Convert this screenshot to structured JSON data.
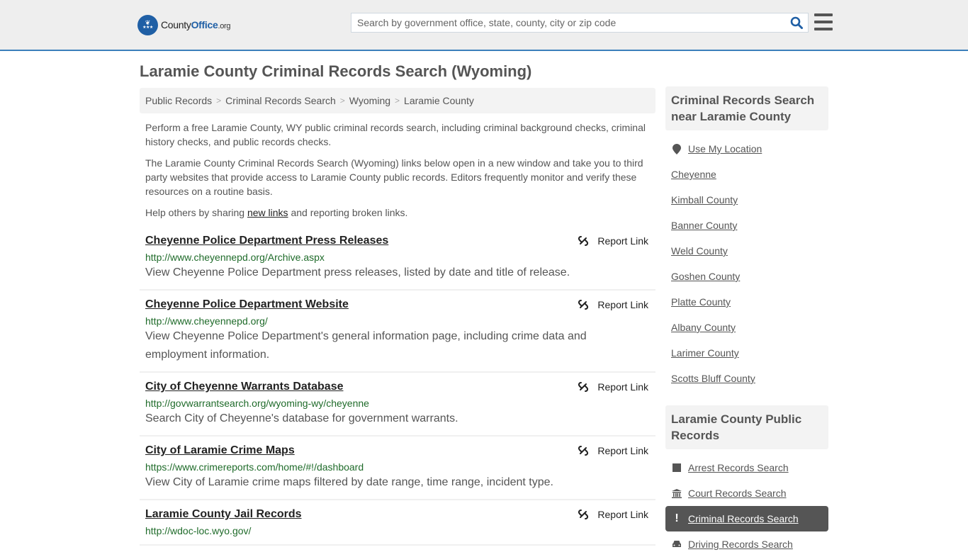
{
  "header": {
    "logo": {
      "name": "County",
      "name_bold": "Office",
      "tld": ".org"
    },
    "search": {
      "placeholder": "Search by government office, state, county, city or zip code",
      "value": ""
    },
    "search_icon": "search-icon",
    "menu_icon": "hamburger-menu-icon"
  },
  "page": {
    "title": "Laramie County Criminal Records Search (Wyoming)"
  },
  "breadcrumb": [
    "Public Records",
    "Criminal Records Search",
    "Wyoming",
    "Laramie County"
  ],
  "intro": {
    "p1": "Perform a free Laramie County, WY public criminal records search, including criminal background checks, criminal history checks, and public records checks.",
    "p2": "The Laramie County Criminal Records Search (Wyoming) links below open in a new window and take you to third party websites that provide access to Laramie County public records. Editors frequently monitor and verify these resources on a routine basis.",
    "p3_before": "Help others by sharing ",
    "p3_link": "new links",
    "p3_after": " and reporting broken links."
  },
  "results": [
    {
      "title": "Cheyenne Police Department Press Releases",
      "url": "http://www.cheyennepd.org/Archive.aspx",
      "description": "View Cheyenne Police Department press releases, listed by date and title of release.",
      "report_label": "Report Link"
    },
    {
      "title": "Cheyenne Police Department Website",
      "url": "http://www.cheyennepd.org/",
      "description": "View Cheyenne Police Department's general information page, including crime data and employment information.",
      "report_label": "Report Link"
    },
    {
      "title": "City of Cheyenne Warrants Database",
      "url": "http://govwarrantsearch.org/wyoming-wy/cheyenne",
      "description": "Search City of Cheyenne's database for government warrants.",
      "report_label": "Report Link"
    },
    {
      "title": "City of Laramie Crime Maps",
      "url": "https://www.crimereports.com/home/#!/dashboard",
      "description": "View City of Laramie crime maps filtered by date range, time range, incident type.",
      "report_label": "Report Link"
    },
    {
      "title": "Laramie County Jail Records",
      "url": "http://wdoc-loc.wyo.gov/",
      "description": "",
      "report_label": "Report Link"
    }
  ],
  "sidebar": {
    "nearby": {
      "heading": "Criminal Records Search near Laramie County",
      "use_location": "Use My Location",
      "items": [
        "Cheyenne",
        "Kimball County",
        "Banner County",
        "Weld County",
        "Goshen County",
        "Platte County",
        "Albany County",
        "Larimer County",
        "Scotts Bluff County"
      ]
    },
    "public_records": {
      "heading": "Laramie County Public Records",
      "items": [
        {
          "label": "Arrest Records Search",
          "icon": "square-icon",
          "active": false
        },
        {
          "label": "Court Records Search",
          "icon": "courthouse-icon",
          "active": false
        },
        {
          "label": "Criminal Records Search",
          "icon": "exclamation-icon",
          "active": true
        },
        {
          "label": "Driving Records Search",
          "icon": "car-icon",
          "active": false
        }
      ]
    }
  },
  "colors": {
    "brand_blue": "#1f5fa5",
    "header_border": "#3c7fbb",
    "url_green": "#1f6b2a",
    "active_bg": "#555555"
  }
}
